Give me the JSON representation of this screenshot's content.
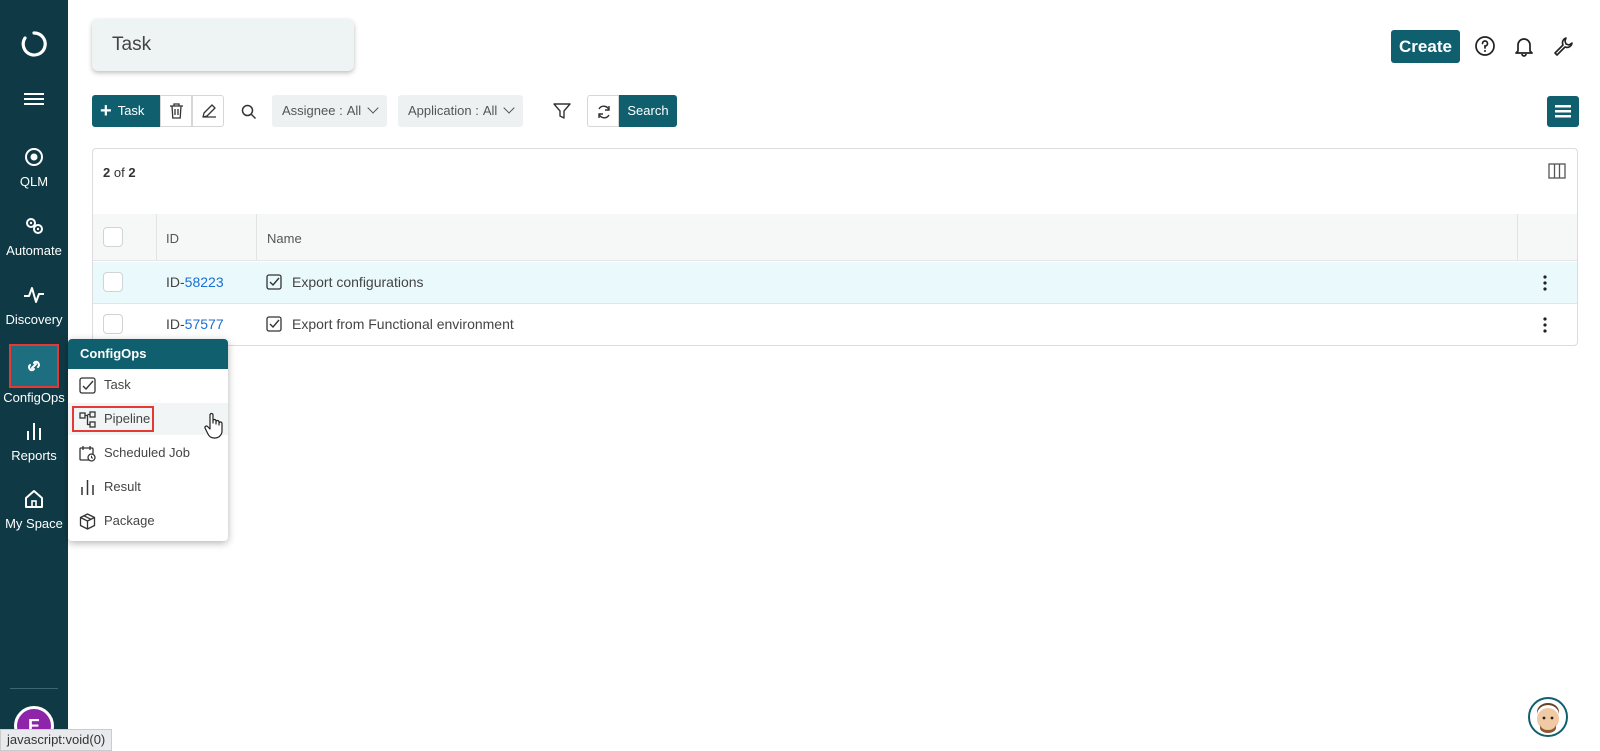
{
  "sidebar": {
    "items": [
      {
        "label": "QLM",
        "icon": "target-icon"
      },
      {
        "label": "Automate",
        "icon": "gears-icon"
      },
      {
        "label": "Discovery",
        "icon": "pulse-icon"
      },
      {
        "label": "ConfigOps",
        "icon": "link-icon"
      },
      {
        "label": "Reports",
        "icon": "bar-chart-icon"
      },
      {
        "label": "My Space",
        "icon": "home-icon"
      }
    ],
    "avatar_initial": "E"
  },
  "page": {
    "title": "Task"
  },
  "header": {
    "create_label": "Create"
  },
  "toolbar": {
    "task_label": "Task",
    "filters": [
      {
        "label": "Assignee :",
        "value": "All"
      },
      {
        "label": "Application :",
        "value": "All"
      }
    ],
    "search_label": "Search"
  },
  "table": {
    "count_shown": "2",
    "count_of": "of",
    "count_total": "2",
    "columns": {
      "id": "ID",
      "name": "Name"
    },
    "rows": [
      {
        "id_prefix": "ID-",
        "id_num": "58223",
        "name": "Export configurations"
      },
      {
        "id_prefix": "ID-",
        "id_num": "57577",
        "name": "Export from Functional environment"
      }
    ]
  },
  "flyout": {
    "title": "ConfigOps",
    "items": [
      {
        "label": "Task",
        "icon": "checkbox-icon"
      },
      {
        "label": "Pipeline",
        "icon": "pipeline-icon"
      },
      {
        "label": "Scheduled Job",
        "icon": "calendar-clock-icon"
      },
      {
        "label": "Result",
        "icon": "bar-chart-icon"
      },
      {
        "label": "Package",
        "icon": "package-icon"
      }
    ]
  },
  "statusbar": {
    "text": "javascript:void(0)"
  },
  "colors": {
    "sidebar": "#0f3a45",
    "accent": "#0f5f6e",
    "link": "#1a6fd1",
    "highlight": "#e53935"
  }
}
